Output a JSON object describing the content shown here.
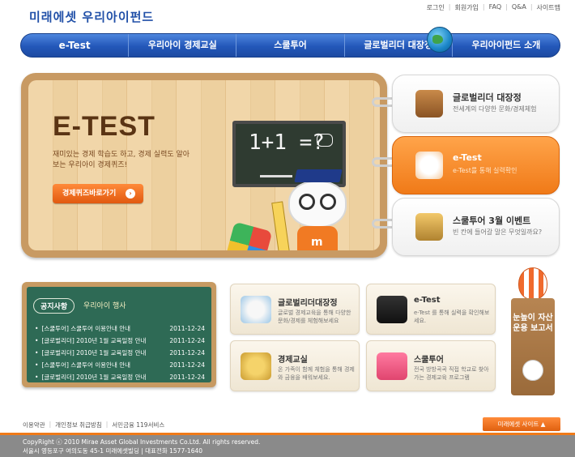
{
  "header": {
    "logo": "미래에셋 우리아이펀드",
    "util_links": [
      "로그인",
      "회원가입",
      "FAQ",
      "Q&A",
      "사이트맵"
    ]
  },
  "nav": {
    "items": [
      "e-Test",
      "우리아이 경제교실",
      "스쿨투어",
      "글로벌리더 대장정",
      "우리아이펀드 소개"
    ]
  },
  "hero": {
    "title": "E-TEST",
    "subtitle": "재미있는 경제 학습도 하고, 경제 실력도 알아보는 우리아이 경제퀴즈!",
    "button": "경제퀴즈바로가기",
    "chalkboard": "1+1 =?"
  },
  "side_tabs": [
    {
      "title": "글로벌리더 대장정",
      "desc": "전세계의 다양한 문화/경제체험",
      "active": false
    },
    {
      "title": "e-Test",
      "desc": "e-Test를 통해 실력확인",
      "active": true
    },
    {
      "title": "스쿨투어 3월 이벤트",
      "desc": "빈 칸에 들어갈 말은 무엇일까요?",
      "active": false
    }
  ],
  "notice": {
    "tag": "공지사항",
    "title": "우리아이 행사",
    "items": [
      {
        "text": "[스쿨투어] 스쿨투어 이용안내 안내",
        "date": "2011-12-24"
      },
      {
        "text": "[글로벌리더] 2010년 1월 교육일정 안내",
        "date": "2011-12-24"
      },
      {
        "text": "[글로벌리더] 2010년 1월 교육일정 안내",
        "date": "2011-12-24"
      },
      {
        "text": "[스쿨투어] 스쿨투어 이용안내 안내",
        "date": "2011-12-24"
      },
      {
        "text": "[글로벌리더] 2010년 1월 교육일정 안내",
        "date": "2011-12-24"
      }
    ]
  },
  "cards": [
    {
      "title": "글로벌리더대장정",
      "desc": "글로벌 경제교육을 통해 다양한 문화/경제를 체험해보세요"
    },
    {
      "title": "e-Test",
      "desc": "e-Test 를 통해 실력을 확인해보세요."
    },
    {
      "title": "경제교실",
      "desc": "온 가족이 함께 체험을 통해 경제와 금융을 배워보세요."
    },
    {
      "title": "스쿨투어",
      "desc": "전국 방방곡곡 직접 학교로 찾아가는 경제교육 프로그램"
    }
  ],
  "banner": {
    "text": "눈높이 자산운용 보고서"
  },
  "footer": {
    "links": [
      "이용약관",
      "개인정보 취급방침",
      "서민금융 119서비스"
    ],
    "family_site": "미래에셋 사이트",
    "copyright": "CopyRight ⓒ 2010 Mirae Asset Global Investments Co.Ltd. All rights reserved.",
    "address": "서울시 영등포구 여의도동 45-1 미래에셋빌딩 | 대표전화 1577-1640"
  },
  "colors": {
    "brand_blue": "#2357b9",
    "accent_orange": "#f07a18",
    "board_green": "#2e6a55",
    "wood": "#c89a63"
  }
}
